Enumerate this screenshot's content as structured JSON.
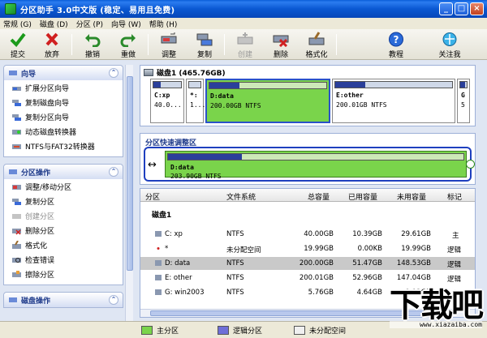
{
  "window": {
    "title": "分区助手 3.0中文版 (稳定、易用且免费)",
    "buttons": [
      "_",
      "□",
      "×"
    ]
  },
  "menu": [
    "常规 (G)",
    "磁盘 (D)",
    "分区 (P)",
    "向导 (W)",
    "帮助 (H)"
  ],
  "toolbar": [
    {
      "label": "提交",
      "icon": "check-icon",
      "enabled": true
    },
    {
      "label": "放弃",
      "icon": "discard-icon",
      "enabled": true
    },
    {
      "label": "撤销",
      "icon": "undo-icon",
      "enabled": true
    },
    {
      "label": "重做",
      "icon": "redo-icon",
      "enabled": true
    },
    {
      "label": "调整",
      "icon": "resize-icon",
      "enabled": true
    },
    {
      "label": "复制",
      "icon": "copy-icon",
      "enabled": true
    },
    {
      "label": "创建",
      "icon": "create-icon",
      "enabled": false
    },
    {
      "label": "删除",
      "icon": "delete-icon",
      "enabled": true
    },
    {
      "label": "格式化",
      "icon": "format-icon",
      "enabled": true
    },
    {
      "label": "教程",
      "icon": "help-icon",
      "enabled": true
    },
    {
      "label": "关注我",
      "icon": "follow-icon",
      "enabled": true
    }
  ],
  "sidebar": {
    "wizard": {
      "title": "向导",
      "items": [
        "扩展分区向导",
        "复制磁盘向导",
        "复制分区向导",
        "动态磁盘转换器",
        "NTFS与FAT32转换器"
      ]
    },
    "partition_ops": {
      "title": "分区操作",
      "items": [
        {
          "label": "调整/移动分区",
          "enabled": true
        },
        {
          "label": "复制分区",
          "enabled": true
        },
        {
          "label": "创建分区",
          "enabled": false
        },
        {
          "label": "删除分区",
          "enabled": true
        },
        {
          "label": "格式化",
          "enabled": true
        },
        {
          "label": "检查错误",
          "enabled": true
        },
        {
          "label": "擦除分区",
          "enabled": true
        }
      ]
    },
    "disk_ops": {
      "title": "磁盘操作"
    }
  },
  "disk_map": {
    "disk_label": "磁盘1 (465.76GB)",
    "partitions": [
      {
        "name": "C:xp",
        "info": "40.0...",
        "used": 0.26
      },
      {
        "name": "*:",
        "info": "1...",
        "used": 0.0
      },
      {
        "name": "D:data",
        "info": "200.00GB NTFS",
        "used": 0.26
      },
      {
        "name": "E:other",
        "info": "200.01GB NTFS",
        "used": 0.26
      },
      {
        "name": "G",
        "info": "5",
        "used": 0.8
      }
    ]
  },
  "resize_area": {
    "title": "分区快速调整区",
    "name": "D:data",
    "info": "203.90GB NTFS",
    "used": 0.25
  },
  "table": {
    "columns": [
      "分区",
      "文件系统",
      "总容量",
      "已用容量",
      "未用容量",
      "标记"
    ],
    "group": "磁盘1",
    "rows": [
      {
        "part": "C:  xp",
        "fs": "NTFS",
        "total": "40.00GB",
        "used": "10.39GB",
        "free": "29.61GB",
        "flag": "主"
      },
      {
        "part": "*",
        "fs": "未分配空间",
        "total": "19.99GB",
        "used": "0.00KB",
        "free": "19.99GB",
        "flag": "逻辑"
      },
      {
        "part": "D:  data",
        "fs": "NTFS",
        "total": "200.00GB",
        "used": "51.47GB",
        "free": "148.53GB",
        "flag": "逻辑"
      },
      {
        "part": "E:  other",
        "fs": "NTFS",
        "total": "200.01GB",
        "used": "52.96GB",
        "free": "147.04GB",
        "flag": "逻辑"
      },
      {
        "part": "G:  win2003",
        "fs": "NTFS",
        "total": "5.76GB",
        "used": "4.64GB",
        "free": "1.12GB",
        "flag": "主"
      }
    ]
  },
  "legend": [
    {
      "label": "主分区",
      "color": "#7ad44b"
    },
    {
      "label": "逻辑分区",
      "color": "#6f6fd8"
    },
    {
      "label": "未分配空间",
      "color": "#f0f0f0"
    }
  ],
  "watermark": {
    "logo": "下载吧",
    "url": "www.xiazaiba.com"
  }
}
